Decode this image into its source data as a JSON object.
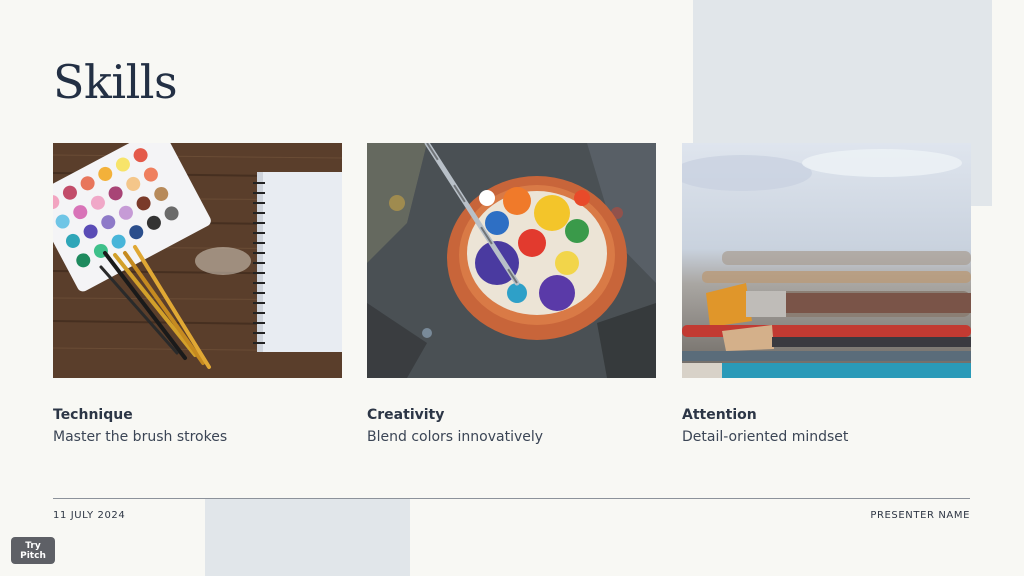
{
  "slide": {
    "title": "Skills",
    "cards": [
      {
        "heading": "Technique",
        "description": "Master the brush strokes",
        "image": "watercolor-palette-brushes-notebook-photo"
      },
      {
        "heading": "Creativity",
        "description": "Blend colors innovatively",
        "image": "paint-palette-bowl-photo"
      },
      {
        "heading": "Attention",
        "description": "Detail-oriented mindset",
        "image": "paintbrushes-closeup-photo"
      }
    ]
  },
  "footer": {
    "date": "11 JULY 2024",
    "presenter": "PRESENTER NAME"
  },
  "badge": {
    "label": "Try Pitch"
  },
  "colors": {
    "background": "#f8f8f4",
    "accent_block": "#e1e6ea",
    "text": "#233044",
    "badge": "#5e6066"
  }
}
